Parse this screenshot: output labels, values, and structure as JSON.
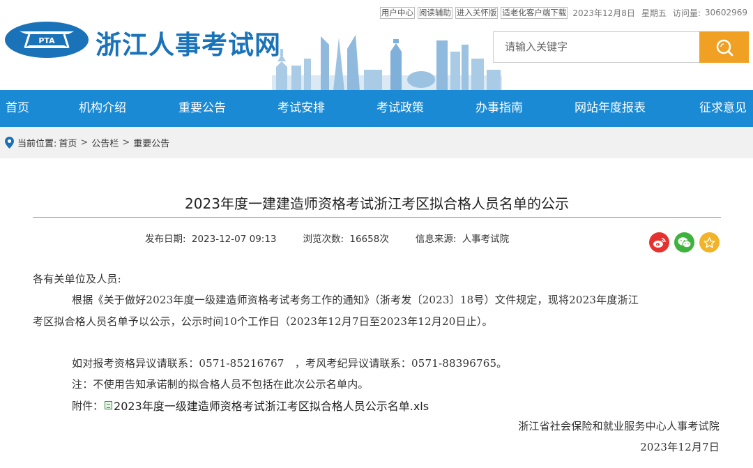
{
  "toplinks": {
    "user_center": "用户中心",
    "reading_aid": "阅读辅助",
    "care_version": "进入关怀版",
    "elderly_download": "适老化客户端下载",
    "date": "2023年12月8日",
    "weekday": "星期五",
    "visits_label": "访问量:",
    "visits_value": "30602969"
  },
  "logo": {
    "text": "PTA"
  },
  "site_name": "浙江人事考试网",
  "search": {
    "placeholder": "请输入关键字"
  },
  "nav": {
    "items": [
      "首页",
      "机构介绍",
      "重要公告",
      "考试安排",
      "考试政策",
      "办事指南",
      "网站年度报表",
      "征求意见"
    ]
  },
  "breadcrumb": {
    "prefix": "当前位置:",
    "items": [
      "首页",
      "公告栏",
      "重要公告"
    ],
    "separator": ">"
  },
  "article": {
    "title": "2023年度一建建造师资格考试浙江考区拟合格人员名单的公示",
    "publish_label": "发布日期:",
    "publish_value": "2023-12-07 09:13",
    "views_label": "浏览次数:",
    "views_value": "16658次",
    "source_label": "信息来源:",
    "source_value": "人事考试院",
    "greeting": "各有关单位及人员:",
    "para1_line1": "根据《关于做好2023年度一级建造师资格考试考务工作的通知》（浙考发〔2023〕18号）文件规定，现将2023年度浙江",
    "para1_line2": "考区拟合格人员名单予以公示，公示时间10个工作日（2023年12月7日至2023年12月20日止）。",
    "contact": "如对报考资格异议请联系：0571-85216767　，考风考纪异议请联系：0571-88396765。",
    "note": "注：不使用告知承诺制的拟合格人员不包括在此次公示名单内。",
    "attachment_label": "附件：",
    "attachment_name": "2023年度一级建造师资格考试浙江考区拟合格人员公示名单.xls",
    "signature": "浙江省社会保险和就业服务中心人事考试院",
    "sign_date": "2023年12月7日"
  },
  "share": {
    "icons": [
      "weibo-icon",
      "wechat-icon",
      "favorite-icon"
    ]
  },
  "colors": {
    "brand_blue": "#1a73b9",
    "nav_blue": "#1b8ad4",
    "search_orange": "#f0a023",
    "weibo_red": "#e6322f",
    "wechat_green": "#3db23d",
    "favorite_yellow": "#f0b32a"
  }
}
